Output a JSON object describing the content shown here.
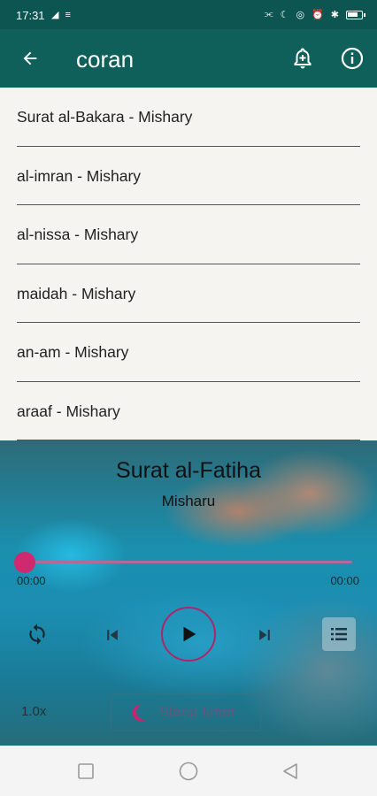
{
  "status_bar": {
    "time": "17:31",
    "left_icons": "◢ ≡",
    "right_icons": [
      "vibrate-icon",
      "moon-icon",
      "location-icon",
      "alarm-icon",
      "bluetooth-icon",
      "battery-icon"
    ]
  },
  "app_bar": {
    "title": "coran",
    "icons": [
      "back-arrow-icon",
      "bell-add-icon",
      "info-icon"
    ]
  },
  "playlist": {
    "items": [
      {
        "label": "Surat al-Bakara - Mishary"
      },
      {
        "label": "al-imran - Mishary"
      },
      {
        "label": "al-nissa - Mishary"
      },
      {
        "label": "maidah - Mishary"
      },
      {
        "label": "an-am - Mishary"
      },
      {
        "label": "araaf - Mishary"
      }
    ]
  },
  "player": {
    "track_title": "Surat al-Fatiha",
    "artist": "Misharu",
    "current_time": "00:00",
    "duration": "00:00",
    "progress": 0,
    "speed": "1.0x",
    "sleep_timer_label": "Sleep timer",
    "icons": [
      "repeat-icon",
      "skip-previous-icon",
      "play-icon",
      "skip-next-icon",
      "playlist-icon",
      "moon-icon"
    ]
  },
  "colors": {
    "app_bar": "#0f5f5a",
    "status_bar": "#0c5550",
    "accent": "#cf2a6f",
    "list_background": "#f5f4f1"
  },
  "nav_bar": {
    "icons": [
      "recents-square-icon",
      "home-circle-icon",
      "back-triangle-icon"
    ]
  }
}
